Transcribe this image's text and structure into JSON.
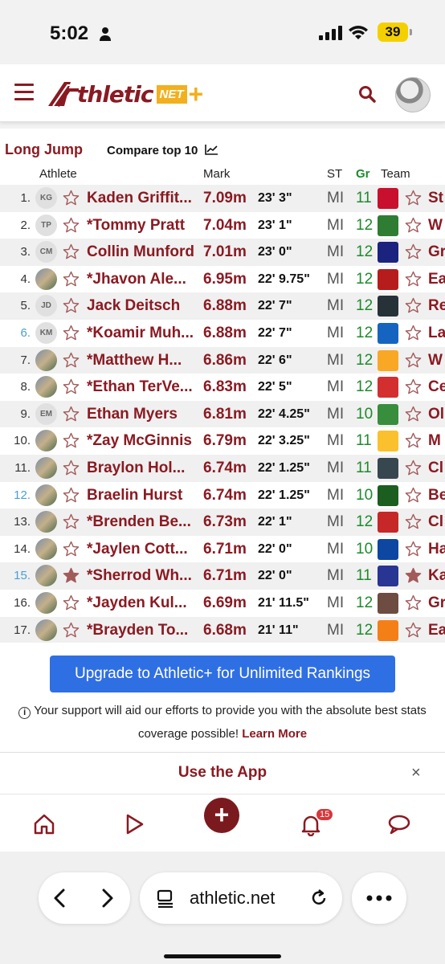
{
  "status_bar": {
    "time": "5:02",
    "battery": "39"
  },
  "header": {
    "logo_text": "thletic",
    "logo_net": "NET",
    "logo_plus": "+"
  },
  "rankings": {
    "event_title": "Long Jump",
    "compare_label": "Compare top 10",
    "columns": {
      "athlete": "Athlete",
      "mark": "Mark",
      "st": "ST",
      "gr": "Gr",
      "team": "Team"
    },
    "rows": [
      {
        "rank": "1.",
        "initials": "KG",
        "name": "Kaden Griffit...",
        "mark": "7.09m",
        "imperial": "23' 3\"",
        "state": "MI",
        "grade": "11",
        "team": "St",
        "tie": false,
        "fav": false
      },
      {
        "rank": "2.",
        "initials": "TP",
        "name": "*Tommy Pratt",
        "mark": "7.04m",
        "imperial": "23' 1\"",
        "state": "MI",
        "grade": "12",
        "team": "W",
        "tie": false,
        "fav": false
      },
      {
        "rank": "3.",
        "initials": "CM",
        "name": "Collin Munford",
        "mark": "7.01m",
        "imperial": "23' 0\"",
        "state": "MI",
        "grade": "12",
        "team": "Gr",
        "tie": false,
        "fav": false
      },
      {
        "rank": "4.",
        "initials": "",
        "name": "*Jhavon Ale...",
        "mark": "6.95m",
        "imperial": "22' 9.75\"",
        "state": "MI",
        "grade": "12",
        "team": "Ea",
        "tie": false,
        "fav": false
      },
      {
        "rank": "5.",
        "initials": "JD",
        "name": "Jack Deitsch",
        "mark": "6.88m",
        "imperial": "22' 7\"",
        "state": "MI",
        "grade": "12",
        "team": "Re",
        "tie": false,
        "fav": false
      },
      {
        "rank": "6.",
        "initials": "KM",
        "name": "*Koamir Muh...",
        "mark": "6.88m",
        "imperial": "22' 7\"",
        "state": "MI",
        "grade": "12",
        "team": "La",
        "tie": true,
        "fav": false
      },
      {
        "rank": "7.",
        "initials": "",
        "name": "*Matthew H...",
        "mark": "6.86m",
        "imperial": "22' 6\"",
        "state": "MI",
        "grade": "12",
        "team": "W",
        "tie": false,
        "fav": false
      },
      {
        "rank": "8.",
        "initials": "",
        "name": "*Ethan TerVe...",
        "mark": "6.83m",
        "imperial": "22' 5\"",
        "state": "MI",
        "grade": "12",
        "team": "Ce",
        "tie": false,
        "fav": false
      },
      {
        "rank": "9.",
        "initials": "EM",
        "name": "Ethan Myers",
        "mark": "6.81m",
        "imperial": "22' 4.25\"",
        "state": "MI",
        "grade": "10",
        "team": "Ol",
        "tie": false,
        "fav": false
      },
      {
        "rank": "10.",
        "initials": "",
        "name": "*Zay McGinnis",
        "mark": "6.79m",
        "imperial": "22' 3.25\"",
        "state": "MI",
        "grade": "11",
        "team": "M",
        "tie": false,
        "fav": false
      },
      {
        "rank": "11.",
        "initials": "",
        "name": "Braylon Hol...",
        "mark": "6.74m",
        "imperial": "22' 1.25\"",
        "state": "MI",
        "grade": "11",
        "team": "Cl",
        "tie": false,
        "fav": false
      },
      {
        "rank": "12.",
        "initials": "",
        "name": "Braelin Hurst",
        "mark": "6.74m",
        "imperial": "22' 1.25\"",
        "state": "MI",
        "grade": "10",
        "team": "Be",
        "tie": true,
        "fav": false
      },
      {
        "rank": "13.",
        "initials": "",
        "name": "*Brenden Be...",
        "mark": "6.73m",
        "imperial": "22' 1\"",
        "state": "MI",
        "grade": "12",
        "team": "Cl",
        "tie": false,
        "fav": false
      },
      {
        "rank": "14.",
        "initials": "",
        "name": "*Jaylen Cott...",
        "mark": "6.71m",
        "imperial": "22' 0\"",
        "state": "MI",
        "grade": "10",
        "team": "Ha",
        "tie": false,
        "fav": false
      },
      {
        "rank": "15.",
        "initials": "",
        "name": "*Sherrod Wh...",
        "mark": "6.71m",
        "imperial": "22' 0\"",
        "state": "MI",
        "grade": "11",
        "team": "Ka",
        "tie": true,
        "fav": true
      },
      {
        "rank": "16.",
        "initials": "",
        "name": "*Jayden Kul...",
        "mark": "6.69m",
        "imperial": "21' 11.5\"",
        "state": "MI",
        "grade": "12",
        "team": "Gr",
        "tie": false,
        "fav": false
      },
      {
        "rank": "17.",
        "initials": "",
        "name": "*Brayden To...",
        "mark": "6.68m",
        "imperial": "21' 11\"",
        "state": "MI",
        "grade": "12",
        "team": "Ea",
        "tie": false,
        "fav": false
      }
    ]
  },
  "upgrade": {
    "button_label": "Upgrade to Athletic+ for Unlimited Rankings",
    "support_text": "Your support will aid our efforts to provide you with the absolute best stats coverage possible!",
    "learn_more": "Learn More"
  },
  "app_banner": {
    "label": "Use the App",
    "close": "×"
  },
  "bottom_nav": {
    "notification_count": "15",
    "plus": "+"
  },
  "browser": {
    "url": "athletic.net"
  },
  "colors": {
    "brand": "#8a1a22",
    "accent_gold": "#f2b01e",
    "grade_green": "#1e8a2d",
    "tie_blue": "#4a9fd0",
    "upgrade_blue": "#2f6fe4"
  }
}
